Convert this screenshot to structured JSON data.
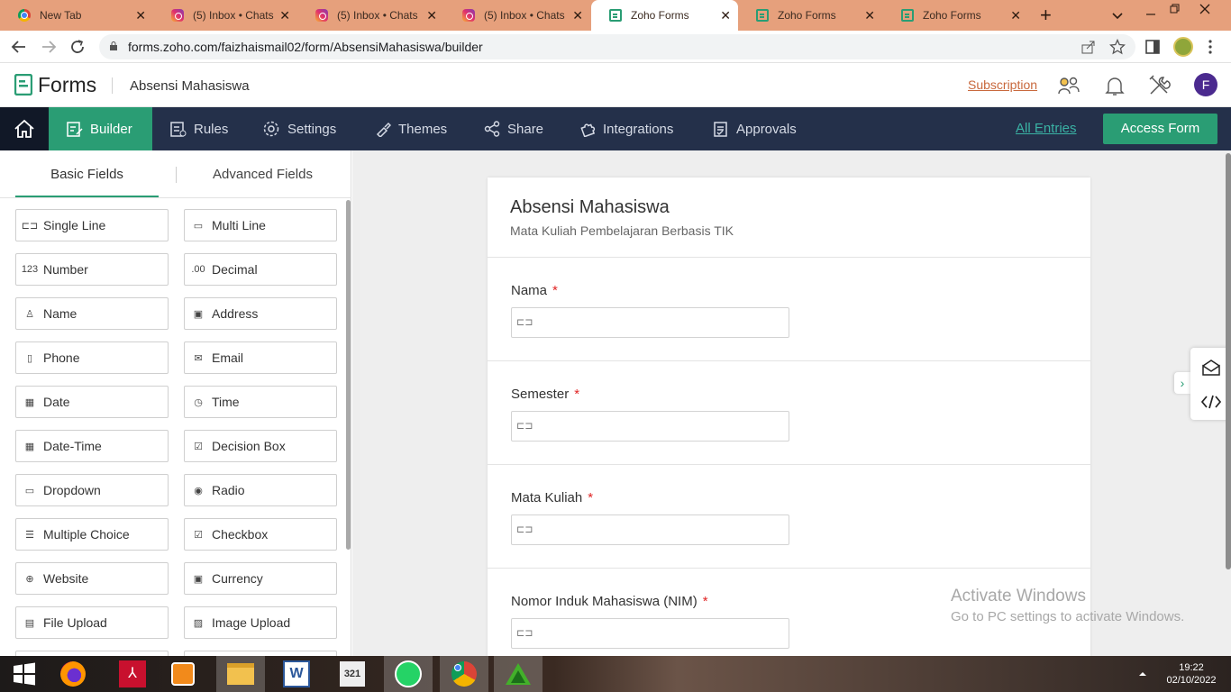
{
  "browser": {
    "tabs": [
      {
        "title": "New Tab",
        "icon": "chrome-icon"
      },
      {
        "title": "(5) Inbox • Chats",
        "icon": "instagram-icon"
      },
      {
        "title": "(5) Inbox • Chats",
        "icon": "instagram-icon"
      },
      {
        "title": "(5) Inbox • Chats",
        "icon": "instagram-icon"
      },
      {
        "title": "Zoho Forms",
        "icon": "zoho-forms-icon",
        "active": true
      },
      {
        "title": "Zoho Forms",
        "icon": "zoho-forms-icon"
      },
      {
        "title": "Zoho Forms",
        "icon": "zoho-forms-icon"
      }
    ],
    "close_glyph": "✕",
    "new_tab_glyph": "+",
    "url": "forms.zoho.com/faizhaismail02/form/AbsensiMahasiswa/builder"
  },
  "app": {
    "name": "Forms",
    "form_name": "Absensi Mahasiswa",
    "subscription": "Subscription",
    "avatar_letter": "F"
  },
  "nav": {
    "items": [
      {
        "label": "Builder",
        "active": true
      },
      {
        "label": "Rules"
      },
      {
        "label": "Settings"
      },
      {
        "label": "Themes"
      },
      {
        "label": "Share"
      },
      {
        "label": "Integrations"
      },
      {
        "label": "Approvals"
      }
    ],
    "all_entries": "All Entries",
    "access_form": "Access Form"
  },
  "panel": {
    "tabs": [
      "Basic Fields",
      "Advanced Fields"
    ],
    "fields_left": [
      {
        "label": "Single Line",
        "icon": "single-line-icon",
        "glyph": "⊏⊐"
      },
      {
        "label": "Number",
        "icon": "number-icon",
        "glyph": "123"
      },
      {
        "label": "Name",
        "icon": "person-icon",
        "glyph": "♙"
      },
      {
        "label": "Phone",
        "icon": "phone-icon",
        "glyph": "▯"
      },
      {
        "label": "Date",
        "icon": "calendar-icon",
        "glyph": "▦"
      },
      {
        "label": "Date-Time",
        "icon": "calendar-clock-icon",
        "glyph": "▦"
      },
      {
        "label": "Dropdown",
        "icon": "dropdown-icon",
        "glyph": "▭"
      },
      {
        "label": "Multiple Choice",
        "icon": "multiple-choice-icon",
        "glyph": "☰"
      },
      {
        "label": "Website",
        "icon": "globe-icon",
        "glyph": "⊕"
      },
      {
        "label": "File Upload",
        "icon": "file-upload-icon",
        "glyph": "▤"
      }
    ],
    "fields_right": [
      {
        "label": "Multi Line",
        "icon": "multi-line-icon",
        "glyph": "▭"
      },
      {
        "label": "Decimal",
        "icon": "decimal-icon",
        "glyph": ".00"
      },
      {
        "label": "Address",
        "icon": "address-icon",
        "glyph": "▣"
      },
      {
        "label": "Email",
        "icon": "mail-icon",
        "glyph": "✉"
      },
      {
        "label": "Time",
        "icon": "clock-icon",
        "glyph": "◷"
      },
      {
        "label": "Decision Box",
        "icon": "checkbox-icon",
        "glyph": "☑"
      },
      {
        "label": "Radio",
        "icon": "radio-icon",
        "glyph": "◉"
      },
      {
        "label": "Checkbox",
        "icon": "checklist-icon",
        "glyph": "☑"
      },
      {
        "label": "Currency",
        "icon": "currency-icon",
        "glyph": "▣"
      },
      {
        "label": "Image Upload",
        "icon": "image-upload-icon",
        "glyph": "▨"
      }
    ]
  },
  "form": {
    "title": "Absensi Mahasiswa",
    "subtitle": "Mata Kuliah Pembelajaran Berbasis TIK",
    "fields": [
      {
        "label": "Nama",
        "required": "*"
      },
      {
        "label": "Semester",
        "required": "*"
      },
      {
        "label": "Mata Kuliah",
        "required": "*"
      },
      {
        "label": "Nomor Induk Mahasiswa (NIM)",
        "required": "*"
      }
    ],
    "input_glyph": "⊏⊐"
  },
  "watermark": {
    "line1": "Activate Windows",
    "line2": "Go to PC settings to activate Windows."
  },
  "taskbar": {
    "time": "19:22",
    "date": "02/10/2022",
    "apps": [
      "windows-start-icon",
      "firefox-icon",
      "acrobat-icon",
      "media-player-icon",
      "file-explorer-icon",
      "word-icon",
      "video-editor-icon",
      "whatsapp-icon",
      "chrome-icon",
      "green-app-icon"
    ]
  },
  "colors": {
    "accent": "#2a9d74",
    "navbar": "#24304a",
    "tabstrip": "#e6a07c",
    "required": "#e02424"
  }
}
